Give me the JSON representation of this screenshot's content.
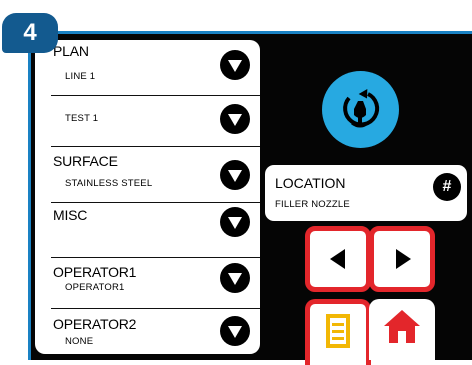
{
  "step": {
    "number": "4"
  },
  "menu": {
    "plan": {
      "label": "PLAN",
      "value": "LINE 1"
    },
    "plan_test": {
      "value": "TEST 1"
    },
    "surface": {
      "label": "SURFACE",
      "value": "STAINLESS STEEL"
    },
    "misc": {
      "label": "MISC"
    },
    "operator1": {
      "label": "OPERATOR1",
      "value": "OPERATOR1"
    },
    "operator2": {
      "label": "OPERATOR2",
      "value": "NONE"
    }
  },
  "location": {
    "label": "LOCATION",
    "value": "FILLER NOZZLE",
    "button_symbol": "#"
  },
  "icons": {
    "reset": "reset-swab-icon",
    "left": "arrow-left-icon",
    "right": "arrow-right-icon",
    "list": "list-icon",
    "home": "home-icon"
  },
  "colors": {
    "frame": "#050505",
    "frame_border": "#1a82c4",
    "badge": "#135a8f",
    "reset_button": "#27a9e1",
    "highlight_border": "#e3262b",
    "list_icon": "#f2b705",
    "home_icon": "#e3262b"
  }
}
